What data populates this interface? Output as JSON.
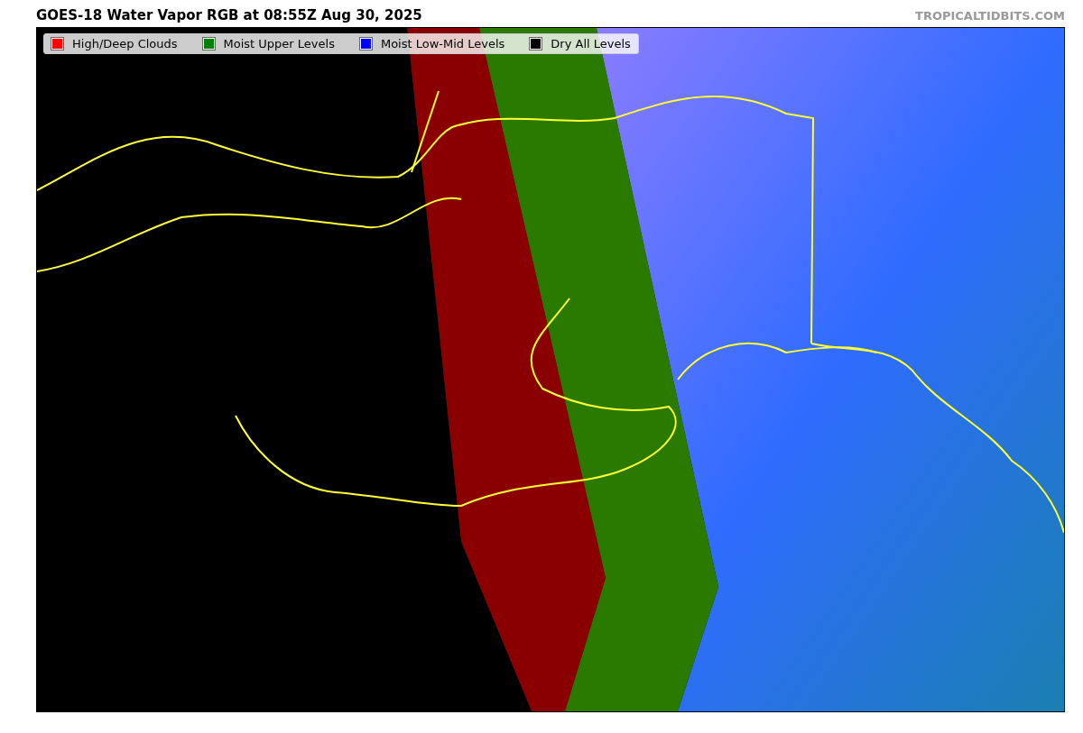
{
  "title": "GOES-18 Water Vapor RGB at 08:55Z Aug 30, 2025",
  "credit": "TROPICALTIDBITS.COM",
  "legend": [
    {
      "label": "High/Deep Clouds",
      "color": "#ff0000"
    },
    {
      "label": "Moist Upper Levels",
      "color": "#008000"
    },
    {
      "label": "Moist Low-Mid Levels",
      "color": "#0000ff"
    },
    {
      "label": "Dry All Levels",
      "color": "#000000"
    }
  ]
}
